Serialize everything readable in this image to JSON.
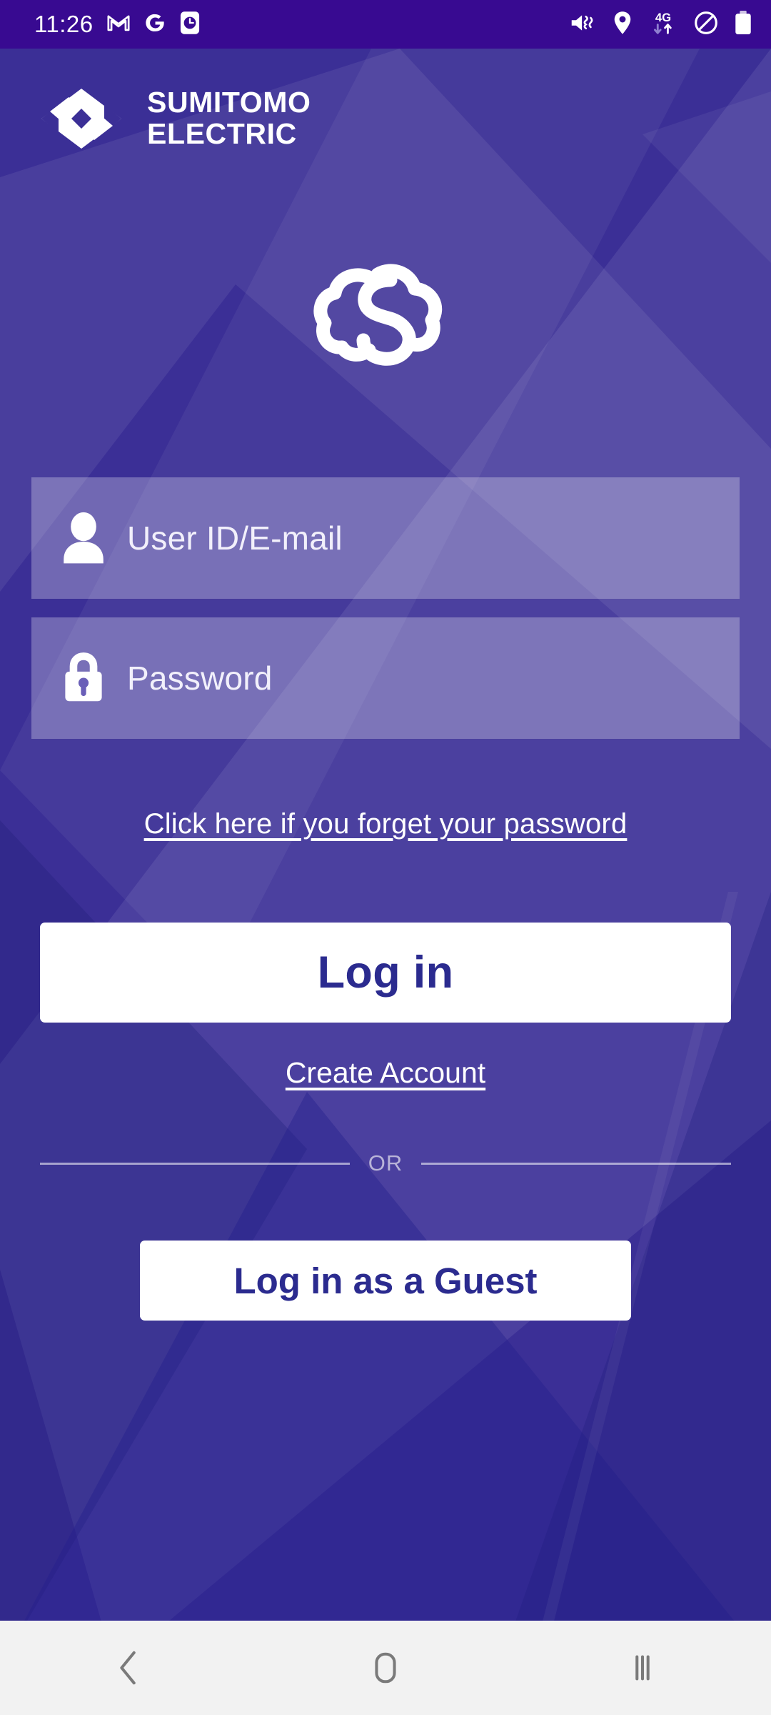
{
  "status_bar": {
    "time": "11:26",
    "background_color": "#380a91",
    "left_icons": [
      {
        "name": "gmail-icon",
        "label": "M"
      },
      {
        "name": "google-icon",
        "label": "G"
      },
      {
        "name": "clock-app-icon",
        "label": "clock"
      }
    ],
    "right_icons": [
      {
        "name": "volume-mute-vibrate-icon",
        "label": "mute"
      },
      {
        "name": "location-pin-icon",
        "label": "location"
      },
      {
        "name": "mobile-data-4g-icon",
        "label": "4G"
      },
      {
        "name": "do-not-disturb-icon",
        "label": "dnd"
      },
      {
        "name": "battery-icon",
        "label": "battery"
      }
    ]
  },
  "brand": {
    "line1": "SUMITOMO",
    "line2": "ELECTRIC",
    "mark_name": "sumitomo-diamond-logo"
  },
  "app_logo": {
    "name": "cloud-s-logo"
  },
  "form": {
    "user_id": {
      "placeholder": "User ID/E-mail",
      "value": "",
      "icon": "person-icon"
    },
    "password": {
      "placeholder": "Password",
      "value": "",
      "icon": "lock-icon"
    },
    "forgot_password_label": "Click here if you forget your password",
    "login_button_label": "Log in",
    "create_account_label": "Create Account",
    "divider_label": "OR",
    "guest_button_label": "Log in as a Guest"
  },
  "nav_bar": {
    "back_label": "back",
    "home_label": "home",
    "recents_label": "recents",
    "background_color": "#f2f2f2"
  },
  "colors": {
    "background_purple": "#3b2f96",
    "status_bar_purple": "#380a91",
    "button_text_navy": "#2b2b8f",
    "field_fill": "rgba(255,255,255,0.28)"
  }
}
